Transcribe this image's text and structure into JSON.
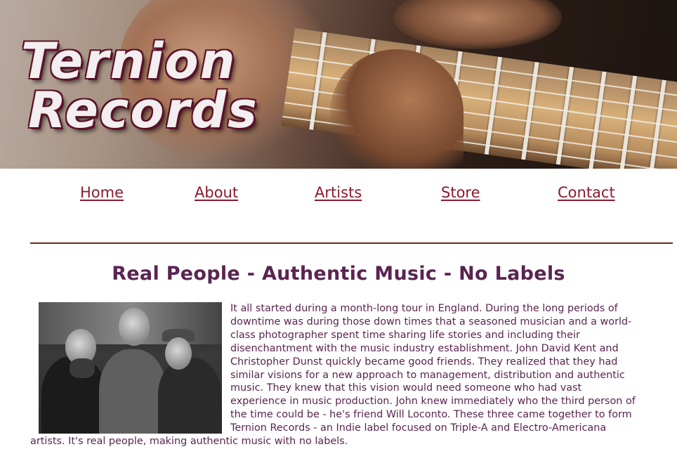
{
  "banner": {
    "logo_line1": "Ternion",
    "logo_line2": "Records"
  },
  "nav": {
    "items": [
      {
        "label": "Home"
      },
      {
        "label": "About"
      },
      {
        "label": "Artists"
      },
      {
        "label": "Store"
      },
      {
        "label": "Contact"
      }
    ]
  },
  "main": {
    "headline": "Real People - Authentic Music - No Labels",
    "body": "It all started during a month-long tour in England. During the long periods of downtime was during those down times that a seasoned musician and a world-class photographer spent time sharing life stories and including their disenchantment with the music industry establishment. John David Kent and Christopher Dunst quickly became good friends. They realized that they had similar visions for a new approach to management, distribution and authentic music. They knew that this vision would need someone who had vast experience in music production. John knew immediately who the third person of the time could be - he's friend Will Loconto. These three came together to form Ternion Records - an Indie label focused on Triple-A and Electro-Americana artists. It's real people, making authentic music with no labels."
  },
  "colors": {
    "nav_link": "#8b1a2e",
    "headline": "#5a2451",
    "body_text": "#5a2451",
    "rule": "#6b2a1c",
    "logo_outline": "#5a1228"
  },
  "icons": {
    "banner_image": "guitar-fretboard-photo",
    "founders_image": "three-founders-photo"
  }
}
